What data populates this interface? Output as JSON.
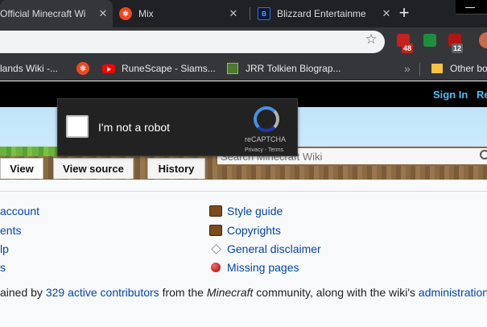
{
  "browser": {
    "tabs": [
      {
        "title": "Official Minecraft Wi",
        "active": true
      },
      {
        "title": "Mix",
        "active": false,
        "icon": "mix-icon"
      },
      {
        "title": "Blizzard Entertainme",
        "active": false,
        "icon": "blizzard-icon"
      }
    ],
    "new_tab_label": "+",
    "close_glyph": "✕",
    "star_glyph": "☆",
    "extension_badges": {
      "gmail": "48",
      "tab_counter": "12"
    },
    "bookmarks": [
      {
        "label": "lands Wiki -...",
        "icon": "none"
      },
      {
        "label": "",
        "icon": "mix-icon"
      },
      {
        "label": "RuneScape - Siams...",
        "icon": "youtube-icon"
      },
      {
        "label": "JRR Tolkien Biograp...",
        "icon": "jrr-icon"
      }
    ],
    "bookmarks_overflow": "»",
    "other_bookmarks": "Other bo"
  },
  "wiki": {
    "header": {
      "sign_in": "Sign In",
      "register": "Re"
    },
    "tabs": {
      "view": "View",
      "view_source": "View source",
      "history": "History"
    },
    "search": {
      "placeholder": "Search Minecraft Wiki"
    },
    "left_links": [
      "account",
      "ents",
      "lp",
      "s"
    ],
    "right_links": [
      {
        "label": "Style guide",
        "icon": "book-icon"
      },
      {
        "label": "Copyrights",
        "icon": "book-icon"
      },
      {
        "label": "General disclaimer",
        "icon": "diamond-outline-icon"
      },
      {
        "label": "Missing pages",
        "icon": "red-ball-icon"
      }
    ],
    "footer": {
      "prefix": "ained by ",
      "contributors_link": "329 active contributors",
      "middle": " from the ",
      "minecraft": "Minecraft",
      "after": " community, along with the wiki's ",
      "admin_link": "administration"
    }
  },
  "recaptcha": {
    "label": "I'm not a robot",
    "brand": "reCAPTCHA",
    "links": "Privacy - Terms"
  },
  "colors": {
    "browser_dark": "#202124",
    "toolbar": "#35363a",
    "link": "#0645ad",
    "sign_in": "#4ec1f6",
    "captcha_bg": "#222222"
  }
}
